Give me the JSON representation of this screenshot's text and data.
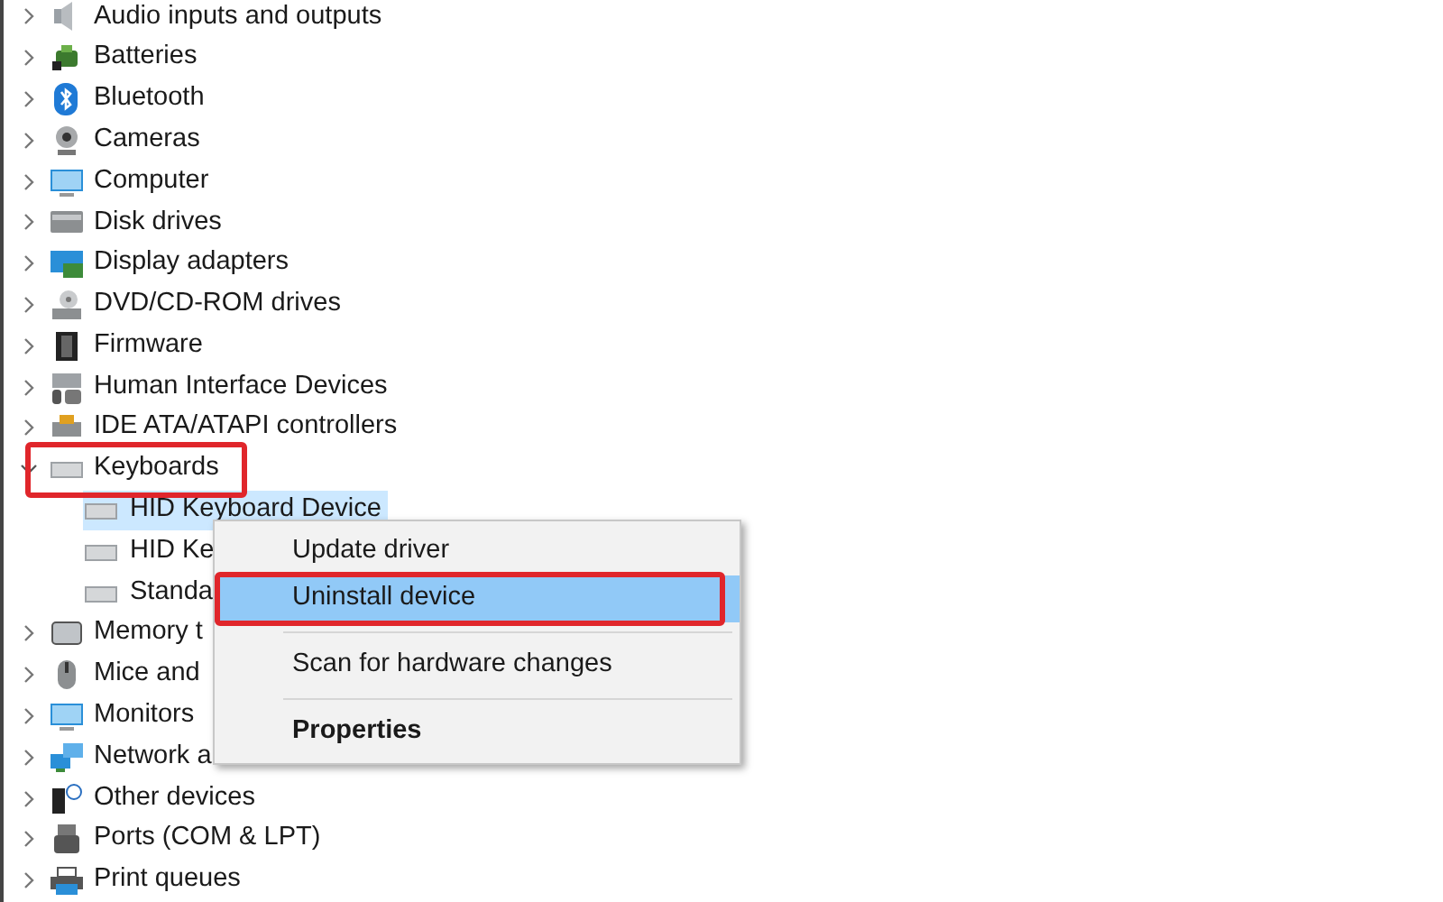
{
  "tree": [
    {
      "label": "Audio inputs and outputs",
      "expanded": false
    },
    {
      "label": "Batteries",
      "expanded": false
    },
    {
      "label": "Bluetooth",
      "expanded": false
    },
    {
      "label": "Cameras",
      "expanded": false
    },
    {
      "label": "Computer",
      "expanded": false
    },
    {
      "label": "Disk drives",
      "expanded": false
    },
    {
      "label": "Display adapters",
      "expanded": false
    },
    {
      "label": "DVD/CD-ROM drives",
      "expanded": false
    },
    {
      "label": "Firmware",
      "expanded": false
    },
    {
      "label": "Human Interface Devices",
      "expanded": false
    },
    {
      "label": "IDE ATA/ATAPI controllers",
      "expanded": false
    },
    {
      "label": "Keyboards",
      "expanded": true,
      "annotated": true,
      "children": [
        {
          "label": "HID Keyboard Device",
          "selected": true
        },
        {
          "label": "HID Ke",
          "selected": false
        },
        {
          "label": "Standa",
          "selected": false
        }
      ]
    },
    {
      "label": "Memory t",
      "expanded": false
    },
    {
      "label": "Mice and",
      "expanded": false
    },
    {
      "label": "Monitors",
      "expanded": false
    },
    {
      "label": "Network a",
      "expanded": false
    },
    {
      "label": "Other devices",
      "expanded": false
    },
    {
      "label": "Ports (COM & LPT)",
      "expanded": false
    },
    {
      "label": "Print queues",
      "expanded": false
    }
  ],
  "context_menu": {
    "items": [
      {
        "kind": "item",
        "label": "Update driver",
        "selected": false
      },
      {
        "kind": "item",
        "label": "Uninstall device",
        "selected": true,
        "annotated": true
      },
      {
        "kind": "separator"
      },
      {
        "kind": "item",
        "label": "Scan for hardware changes",
        "selected": false
      },
      {
        "kind": "separator"
      },
      {
        "kind": "bold",
        "label": "Properties",
        "selected": false
      }
    ]
  }
}
